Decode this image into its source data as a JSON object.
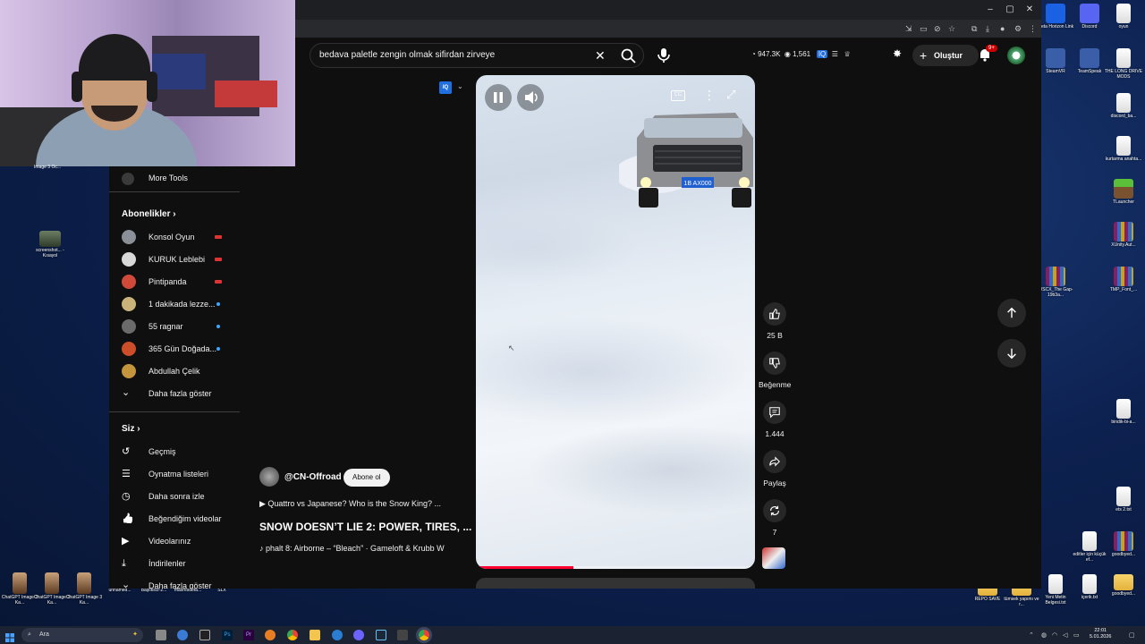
{
  "browser": {
    "search_query": "bedava paletle zengin olmak sifirdan zirveye",
    "views_stat": "947.3K",
    "eye_stat": "1,561",
    "create_label": "Oluştur",
    "notif_count": "9+"
  },
  "sidebar": {
    "more_tools": "More Tools",
    "subs_header": "Abonelikler",
    "channels": [
      {
        "name": "Konsol Oyun",
        "status": "live",
        "color": "#8a8f98"
      },
      {
        "name": "KURUK Leblebi",
        "status": "live",
        "color": "#d8d8d8"
      },
      {
        "name": "Pintipanda",
        "status": "live",
        "color": "#d04a3a"
      },
      {
        "name": "1 dakikada lezze...",
        "status": "new",
        "color": "#c9b37a"
      },
      {
        "name": "55 ragnar",
        "status": "new",
        "color": "#6b6b6b"
      },
      {
        "name": "365 Gün Doğada...",
        "status": "new",
        "color": "#cc4d2a"
      },
      {
        "name": "Abdullah Çelik",
        "status": "none",
        "color": "#c4953d"
      }
    ],
    "show_more": "Daha fazla göster",
    "you_header": "Siz",
    "you_items": [
      {
        "label": "Geçmiş",
        "icon": "history-icon"
      },
      {
        "label": "Oynatma listeleri",
        "icon": "playlists-icon"
      },
      {
        "label": "Daha sonra izle",
        "icon": "watch-later-icon"
      },
      {
        "label": "Beğendiğim videolar",
        "icon": "like-icon"
      },
      {
        "label": "Videolarınız",
        "icon": "your-videos-icon"
      },
      {
        "label": "İndirilenler",
        "icon": "download-icon"
      }
    ],
    "show_more_2": "Daha fazla göster"
  },
  "short": {
    "channel": "@CN-Offroad",
    "subscribe": "Abone ol",
    "related": "▶ Quattro vs Japanese? Who is the Snow King? ...",
    "title": "SNOW DOESN’T LIE 2: POWER, TIRES, ...",
    "music": "♪ phalt 8: Airborne – “Bleach” · Gameloft & Krubb W",
    "plate": "1B AX000",
    "progress": 0.35
  },
  "actions": {
    "likes": "25 B",
    "dislike": "Beğenme",
    "comments": "1.444",
    "share": "Paylaş",
    "remix": "7"
  },
  "desktop": {
    "icons_right": [
      {
        "label": "Meta Horizon Link",
        "type": "meta"
      },
      {
        "label": "Discord",
        "type": "discord"
      },
      {
        "label": "oyun",
        "type": "file"
      },
      {
        "label": "SteamVR",
        "type": "round"
      },
      {
        "label": "TeamSpeak",
        "type": "round"
      },
      {
        "label": "THE LONG DRIVE MODS",
        "type": "file"
      },
      {
        "label": "discord_ba...",
        "type": "file"
      },
      {
        "label": "kurtarma anahta...",
        "type": "file"
      },
      {
        "label": "TLauncher",
        "type": "mc"
      },
      {
        "label": "XUnity.Aut...",
        "type": "rar"
      },
      {
        "label": "WSCX_The Gap-19b3a...",
        "type": "rar"
      },
      {
        "label": "TMP_Font_...",
        "type": "rar"
      },
      {
        "label": "bindik-bi-a...",
        "type": "file"
      },
      {
        "label": "ets 2.txt",
        "type": "file"
      },
      {
        "label": "editler için küçük ef...",
        "type": "file"
      },
      {
        "label": "goodbyed...",
        "type": "rar"
      },
      {
        "label": "REPO SAVE",
        "type": "folder"
      },
      {
        "label": "tümsek yapımı ve r...",
        "type": "folder"
      },
      {
        "label": "Yeni Metin Belgesi.txt",
        "type": "file"
      },
      {
        "label": "içerik.txt",
        "type": "file"
      },
      {
        "label": "goodbyed...",
        "type": "folder"
      }
    ],
    "icons_left": [
      {
        "label": "screenshot... - Kısayol",
        "type": "img"
      },
      {
        "label": "ChatGPT Image 3 Ka...",
        "type": "person"
      },
      {
        "label": "ChatGPT Image 3 Ka...",
        "type": "person"
      },
      {
        "label": "ChatGPT Image 3 Ka...",
        "type": "person"
      },
      {
        "label": "unnamed...",
        "type": "slx"
      },
      {
        "label": "Başlıksız-2...",
        "type": "slx"
      },
      {
        "label": "maxresdefa...",
        "type": "slx"
      },
      {
        "label": "SLX",
        "type": "slx"
      }
    ],
    "cam_label": "Image 3 Oc..."
  },
  "taskbar": {
    "search_label": "Ara",
    "time": "22:01",
    "date": "5.01.2026"
  }
}
